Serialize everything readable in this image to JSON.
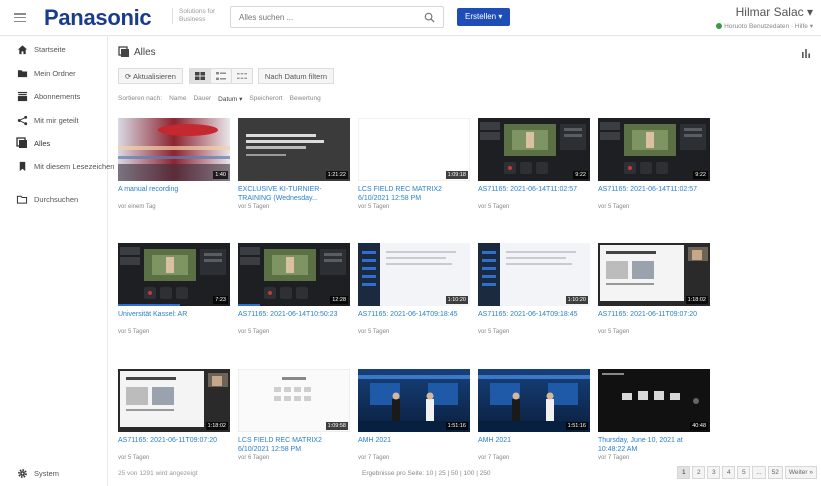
{
  "header": {
    "brand": "Panasonic",
    "subbrand": "Solutions for Business",
    "search_placeholder": "Alles suchen ...",
    "create_label": "Erstellen ▾",
    "user_name": "Hilmar Salac ▾",
    "user_sub": "Horuoto Benutzedaten · Hilfe ▾"
  },
  "sidebar": {
    "items": [
      {
        "label": "Startseite",
        "icon": "home-icon"
      },
      {
        "label": "Mein Ordner",
        "icon": "folder-icon"
      },
      {
        "label": "Abonnements",
        "icon": "subscriptions-icon"
      },
      {
        "label": "Mit mir geteilt",
        "icon": "share-icon"
      },
      {
        "label": "Alles",
        "icon": "library-icon"
      },
      {
        "label": "Mit diesem Lesezeichen",
        "icon": "bookmark-icon"
      },
      {
        "label": "Durchsuchen",
        "icon": "browse-icon"
      }
    ],
    "system": "System"
  },
  "main": {
    "title": "Alles",
    "toolbar": {
      "refresh": "⟳ Aktualisieren",
      "filter_date": "Nach Datum filtern"
    },
    "sort": {
      "label": "Sortieren nach:",
      "options": [
        "Name",
        "Dauer",
        "Datum ▾",
        "Speicherort",
        "Bewertung"
      ],
      "selected": 2
    },
    "cards": [
      {
        "title": "A manual recording",
        "sub": "vor einem Tag",
        "duration": "1:40",
        "thumb": "motion",
        "progress": 0
      },
      {
        "title": "EXCLUSIVE KI-TURNIER-TRAINING (Wednesday...",
        "sub": "vor 5 Tagen",
        "duration": "1:21:22",
        "thumb": "slide",
        "progress": 0
      },
      {
        "title": "LCS FIELD REC MATRIX2 6/10/2021 12:58 PM",
        "sub": "vor 5 Tagen",
        "duration": "1:09:18",
        "thumb": "blank",
        "progress": 0
      },
      {
        "title": "AS71165: 2021-06-14T11:02:57",
        "sub": "vor 5 Tagen",
        "duration": "9:22",
        "thumb": "studio",
        "progress": 0
      },
      {
        "title": "AS71165: 2021-06-14T11:02:57",
        "sub": "vor 5 Tagen",
        "duration": "9:22",
        "thumb": "studio",
        "progress": 0
      },
      {
        "title": "Universität Kassel: AR",
        "sub": "vor 5 Tagen",
        "duration": "7:23",
        "thumb": "studio",
        "progress": 0.55
      },
      {
        "title": "AS71165: 2021-06-14T10:50:23",
        "sub": "vor 5 Tagen",
        "duration": "12:28",
        "thumb": "studio",
        "progress": 0.2
      },
      {
        "title": "AS71165: 2021-06-14T09:18:45",
        "sub": "vor 5 Tagen",
        "duration": "1:10:20",
        "thumb": "desktop",
        "progress": 0
      },
      {
        "title": "AS71165: 2021-06-14T09:18:45",
        "sub": "vor 5 Tagen",
        "duration": "1:10:20",
        "thumb": "desktop",
        "progress": 0
      },
      {
        "title": "AS71165: 2021-06-11T09:07:20",
        "sub": "vor 5 Tagen",
        "duration": "1:18:02",
        "thumb": "slides",
        "progress": 0
      },
      {
        "title": "AS71165: 2021-06-11T09:07:20",
        "sub": "vor 5 Tagen",
        "duration": "1:18:02",
        "thumb": "slides",
        "progress": 0
      },
      {
        "title": "LCS FIELD REC MATRIX2 6/10/2021 12:58 PM",
        "sub": "vor 6 Tagen",
        "duration": "1:09:58",
        "thumb": "calendar",
        "progress": 0
      },
      {
        "title": "AMH 2021",
        "sub": "vor 7 Tagen",
        "duration": "1:51:16",
        "thumb": "stage",
        "progress": 0
      },
      {
        "title": "AMH 2021",
        "sub": "vor 7 Tagen",
        "duration": "1:51:16",
        "thumb": "stage",
        "progress": 0
      },
      {
        "title": "Thursday, June 10, 2021 at 10:48:22 AM",
        "sub": "vor 7 Tagen",
        "duration": "40:48",
        "thumb": "dark",
        "progress": 0
      }
    ],
    "footer": {
      "count": "25 von 1291 wird angezeigt",
      "pagesize": "Ergebnisse pro Seite: 10 | 25 | 50 | 100 | 250",
      "pages": [
        "1",
        "2",
        "3",
        "4",
        "5",
        "...",
        "52",
        "Weiter »"
      ],
      "active_page": 0
    }
  },
  "colors": {
    "brand": "#1a3c8f",
    "accent": "#1e4db7",
    "link": "#2a80c8"
  }
}
